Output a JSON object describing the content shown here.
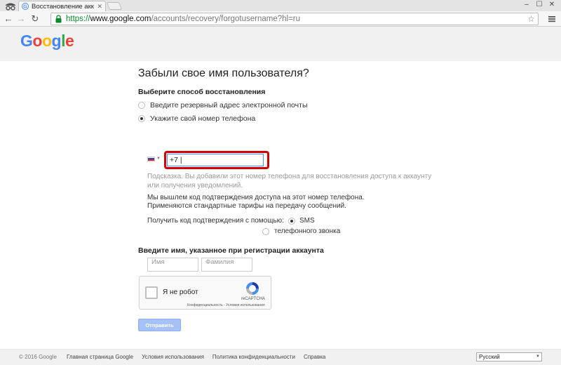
{
  "browser": {
    "tab_title": "Восстановление аккаунт",
    "url_scheme": "https://",
    "url_host": "www.google.com",
    "url_path": "/accounts/recovery/forgotusername?hl=ru"
  },
  "header": {
    "logo_text": "Google"
  },
  "main": {
    "title": "Забыли свое имя пользователя?",
    "method_label": "Выберите способ восстановления",
    "option_email": "Введите резервный адрес электронной почты",
    "option_phone": "Укажите свой номер телефона",
    "phone_value": "+7 |",
    "hint": "Подсказка. Вы добавили этот номер телефона для восстановления доступа к аккаунту или получения уведомлений.",
    "info_line1": "Мы вышлем код подтверждения доступа на этот номер телефона.",
    "info_line2": "Применяются стандартные тарифы на передачу сообщений.",
    "via_label": "Получить код подтверждения с помощью:",
    "via_sms": "SMS",
    "via_call": "телефонного звонка",
    "name_label": "Введите имя, указанное при регистрации аккаунта",
    "first_name_placeholder": "Имя",
    "last_name_placeholder": "Фамилия",
    "captcha_label": "Я не робот",
    "captcha_brand": "reCAPTCHA",
    "captcha_links": "Конфиденциальность - Условия использования",
    "submit_label": "Отправить"
  },
  "footer": {
    "copyright": "© 2016 Google",
    "links": [
      "Главная страница Google",
      "Условия использования",
      "Политика конфиденциальности",
      "Справка"
    ],
    "language": "Русский"
  },
  "colors": {
    "accent_blue": "#4285f4",
    "highlight_red": "#d40000",
    "submit_disabled": "#a6c1f5"
  }
}
